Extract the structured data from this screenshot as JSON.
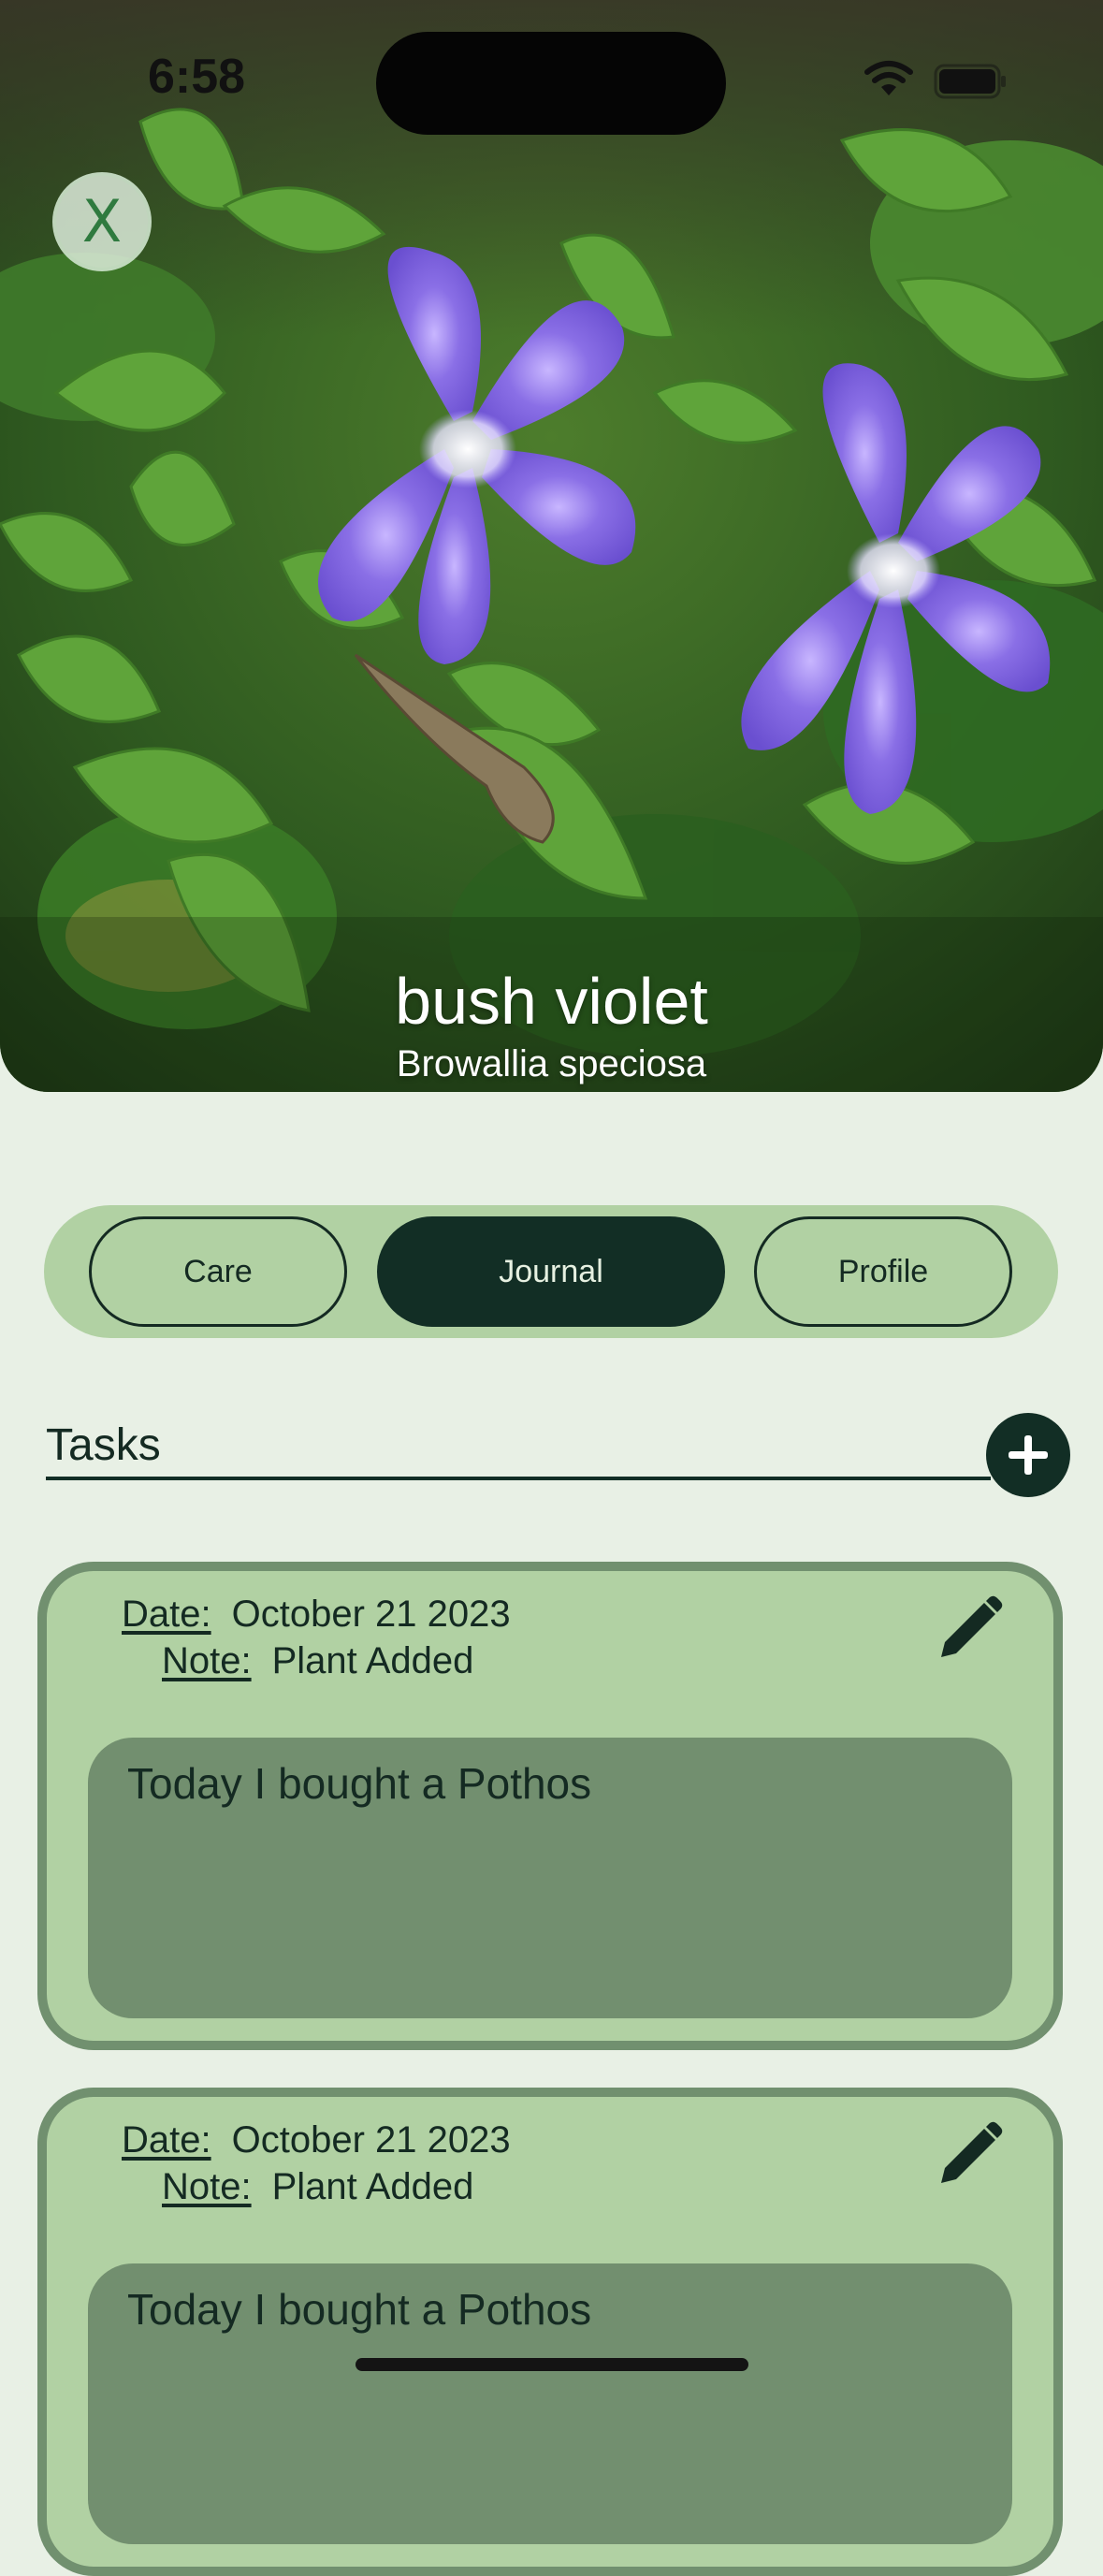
{
  "status_bar": {
    "time": "6:58"
  },
  "hero": {
    "common_name": "bush violet",
    "scientific_name": "Browallia speciosa"
  },
  "close_button": {
    "label": "X"
  },
  "tabs": [
    {
      "label": "Care",
      "active": false
    },
    {
      "label": "Journal",
      "active": true
    },
    {
      "label": "Profile",
      "active": false
    }
  ],
  "tasks": {
    "title": "Tasks"
  },
  "journal_entries": [
    {
      "date_label": "Date:",
      "date_value": "October 21 2023",
      "note_label": "Note:",
      "note_value": "Plant Added",
      "text": "Today I bought a Pothos"
    },
    {
      "date_label": "Date:",
      "date_value": "October 21 2023",
      "note_label": "Note:",
      "note_value": "Plant Added",
      "text": "Today I bought a Pothos"
    }
  ],
  "colors": {
    "background": "#e8f0e5",
    "accent_dark": "#122e25",
    "card_fill": "#b1d1a3",
    "card_border": "#71906f",
    "note_fill": "#728f6f"
  }
}
